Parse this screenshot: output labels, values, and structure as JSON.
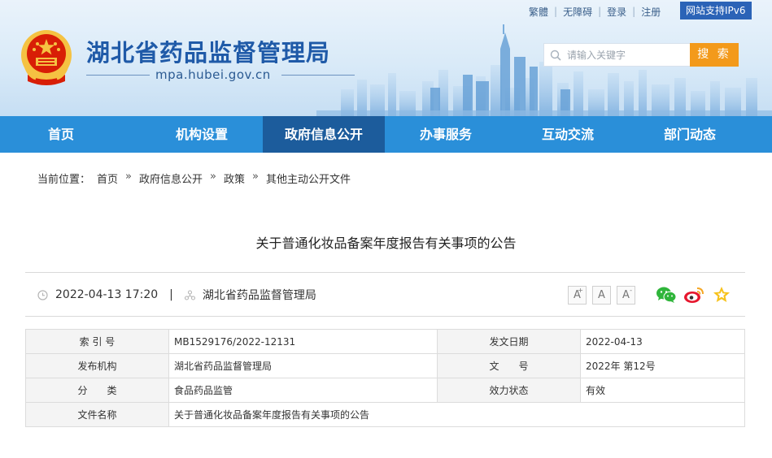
{
  "header": {
    "site_title": "湖北省药品监督管理局",
    "site_domain": "mpa.hubei.gov.cn",
    "toplinks": [
      "繁體",
      "无障碍",
      "登录",
      "注册"
    ],
    "ipv6_badge": "网站支持IPv6",
    "search_placeholder": "请输入关键字",
    "search_button": "搜 索"
  },
  "nav": {
    "items": [
      "首页",
      "机构设置",
      "政府信息公开",
      "办事服务",
      "互动交流",
      "部门动态"
    ],
    "active": "政府信息公开"
  },
  "breadcrumb": {
    "label": "当前位置：",
    "items": [
      "首页",
      "政府信息公开",
      "政策",
      "其他主动公开文件"
    ],
    "separator": "»"
  },
  "article": {
    "title": "关于普通化妆品备案年度报告有关事项的公告",
    "datetime": "2022-04-13 17:20",
    "source": "湖北省药品监督管理局",
    "font_buttons": [
      "A+",
      "A",
      "A-"
    ],
    "share_icons": [
      "wechat-icon",
      "weibo-icon",
      "favorite-icon"
    ]
  },
  "info_table": {
    "rows": [
      {
        "label1": "索 引 号",
        "value1": "MB1529176/2022-12131",
        "label2": "发文日期",
        "value2": "2022-04-13"
      },
      {
        "label1": "发布机构",
        "value1": "湖北省药品监督管理局",
        "label2": "文　　号",
        "value2": "2022年 第12号"
      },
      {
        "label1": "分　　类",
        "value1": "食品药品监管",
        "label2": "效力状态",
        "value2": "有效"
      }
    ],
    "last_row": {
      "label": "文件名称",
      "value": "关于普通化妆品备案年度报告有关事项的公告"
    }
  },
  "colors": {
    "brand_blue": "#1f5aa8",
    "nav_blue": "#2a8fd9",
    "nav_active": "#1c5c9c",
    "search_orange": "#f39a1b",
    "emblem_red": "#d81e06",
    "emblem_gold": "#f5c242"
  }
}
